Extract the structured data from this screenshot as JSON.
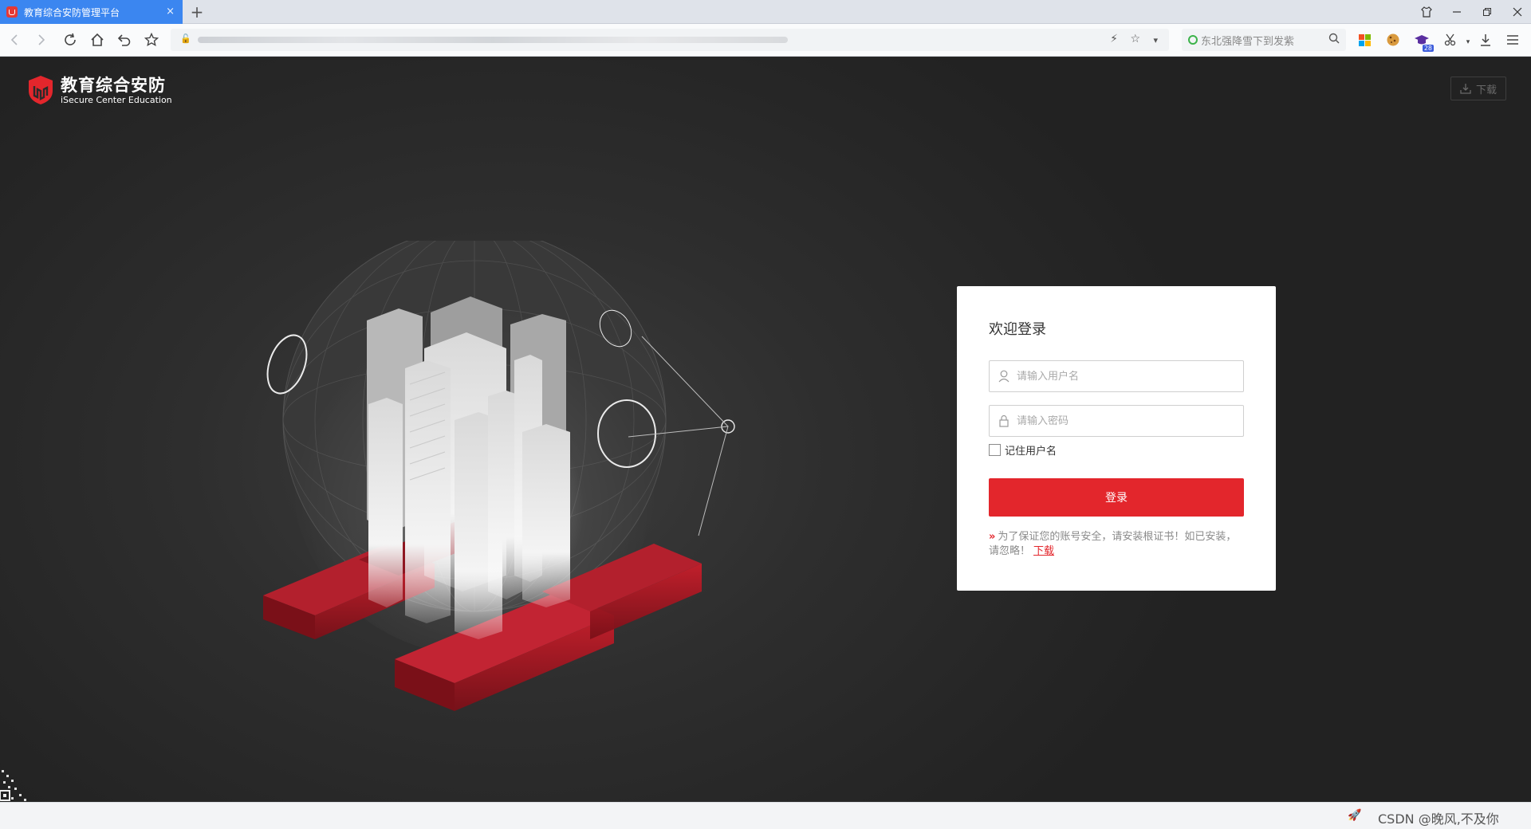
{
  "browser": {
    "tab_title": "教育综合安防管理平台",
    "tab_close": "×",
    "new_tab": "+",
    "search_placeholder": "东北强降雪下到发紫",
    "ext_badge": "28"
  },
  "header": {
    "logo_title": "教育综合安防",
    "logo_subtitle": "iSecure Center Education",
    "download_label": "下载"
  },
  "login": {
    "title": "欢迎登录",
    "username_placeholder": "请输入用户名",
    "password_placeholder": "请输入密码",
    "remember_label": "记住用户名",
    "remember_checked": false,
    "submit_label": "登录",
    "notice_text": "为了保证您的账号安全，请安装根证书！如已安装，请忽略！",
    "notice_link": "下载"
  },
  "colors": {
    "accent": "#e3262c",
    "tab_active": "#3b86f0",
    "page_bg": "#2a2a2a"
  },
  "watermark": "CSDN @晚风,不及你"
}
